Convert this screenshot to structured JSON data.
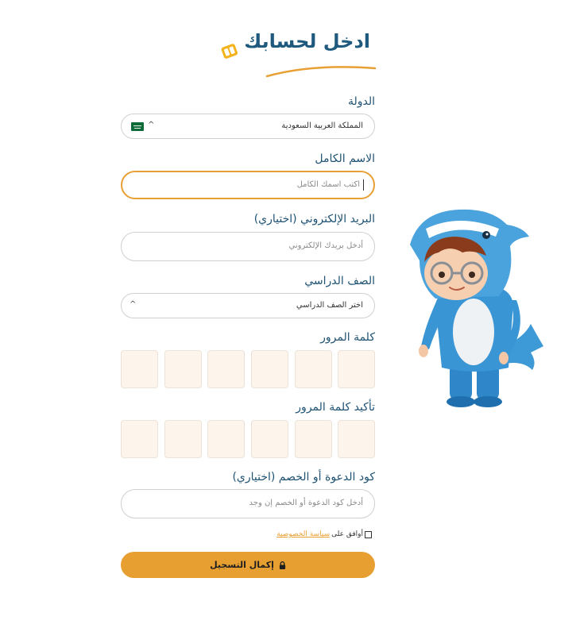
{
  "header": {
    "title": "ادخل لحسابك"
  },
  "country": {
    "label": "الدولة",
    "value": "المملكة العربية السعودية",
    "flag_icon": "saudi-flag-icon"
  },
  "full_name": {
    "label": "الاسم الكامل",
    "placeholder": "اكتب اسمك الكامل"
  },
  "email": {
    "label": "البريد الإلكتروني (اختياري)",
    "placeholder": "أدخل بريدك الإلكتروني"
  },
  "grade": {
    "label": "الصف الدراسي",
    "value": "اختر الصف الدراسي"
  },
  "password": {
    "label": "كلمة المرور"
  },
  "confirm_password": {
    "label": "تأكيد كلمة المرور"
  },
  "invite_code": {
    "label": "كود الدعوة أو الخصم (اختياري)",
    "placeholder": "أدخل كود الدعوة أو الخصم إن وجد"
  },
  "agreement": {
    "prefix": "أوافق على",
    "link": "سياسة الخصوصية"
  },
  "submit": {
    "label": "إكمال التسجيل",
    "icon": "lock-icon"
  },
  "colors": {
    "accent": "#e89f32",
    "heading": "#1f5a7e",
    "pin_bg": "#fdf5ec"
  }
}
